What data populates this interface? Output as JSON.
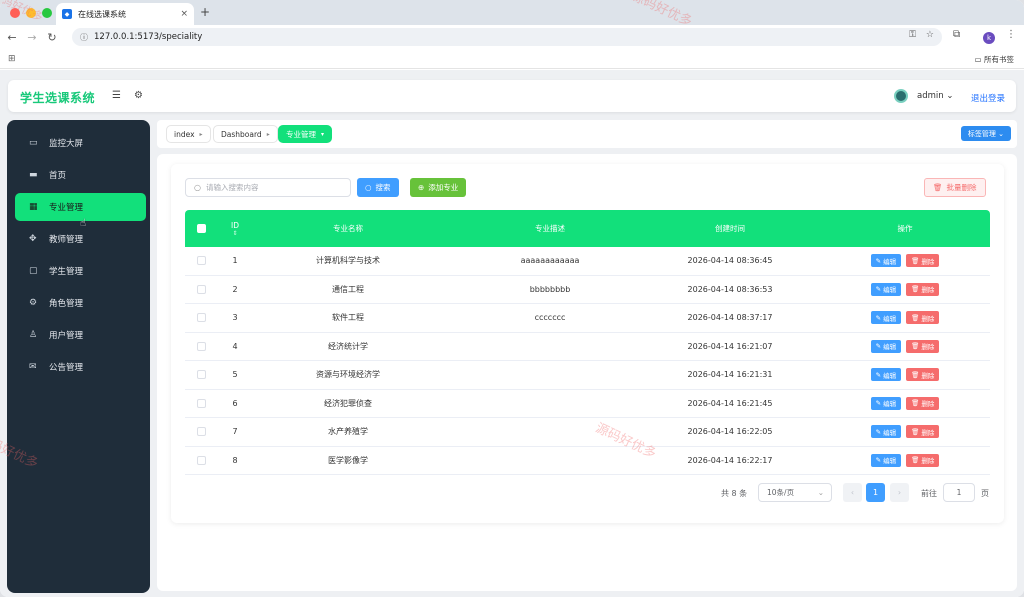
{
  "browser": {
    "tab_title": "在线选课系统",
    "tab_close": "×",
    "new_tab": "+",
    "url": "127.0.0.1:5173/speciality",
    "bookmarks_all": "所有书签",
    "profile_initial": "k"
  },
  "header": {
    "logo": "学生选课系统",
    "username": "admin",
    "logout": "退出登录"
  },
  "sidebar": {
    "items": [
      {
        "label": "监控大屏",
        "icon": "monitor-icon"
      },
      {
        "label": "首页",
        "icon": "desktop-icon"
      },
      {
        "label": "专业管理",
        "icon": "building-icon",
        "active": true
      },
      {
        "label": "教师管理",
        "icon": "move-icon"
      },
      {
        "label": "学生管理",
        "icon": "briefcase-icon"
      },
      {
        "label": "角色管理",
        "icon": "gear-icon"
      },
      {
        "label": "用户管理",
        "icon": "user-icon"
      },
      {
        "label": "公告管理",
        "icon": "mail-icon"
      }
    ]
  },
  "tags": {
    "items": [
      "index",
      "Dashboard",
      "专业管理"
    ],
    "manage": "标签管理"
  },
  "toolbar": {
    "search_placeholder": "请输入搜索内容",
    "search_button": "搜索",
    "add_button": "添加专业",
    "batch_delete": "批量删除"
  },
  "table": {
    "headers": {
      "id": "ID",
      "name": "专业名称",
      "desc": "专业描述",
      "created": "创建时间",
      "actions": "操作"
    },
    "edit_label": "编辑",
    "delete_label": "删除",
    "rows": [
      {
        "id": "1",
        "name": "计算机科学与技术",
        "desc": "aaaaaaaaaaaa",
        "created": "2026-04-14 08:36:45"
      },
      {
        "id": "2",
        "name": "通信工程",
        "desc": "bbbbbbbb",
        "created": "2026-04-14 08:36:53"
      },
      {
        "id": "3",
        "name": "软件工程",
        "desc": "ccccccc",
        "created": "2026-04-14 08:37:17"
      },
      {
        "id": "4",
        "name": "经济统计学",
        "desc": "",
        "created": "2026-04-14 16:21:07"
      },
      {
        "id": "5",
        "name": "资源与环境经济学",
        "desc": "",
        "created": "2026-04-14 16:21:31"
      },
      {
        "id": "6",
        "name": "经济犯罪侦查",
        "desc": "",
        "created": "2026-04-14 16:21:45"
      },
      {
        "id": "7",
        "name": "水产养殖学",
        "desc": "",
        "created": "2026-04-14 16:22:05"
      },
      {
        "id": "8",
        "name": "医学影像学",
        "desc": "",
        "created": "2026-04-14 16:22:17"
      }
    ]
  },
  "pagination": {
    "total": "共 8 条",
    "page_size": "10条/页",
    "current": "1",
    "goto_prefix": "前往",
    "goto_value": "1",
    "goto_suffix": "页"
  },
  "watermark": "源码好优多",
  "colors": {
    "accent": "#12e07b",
    "primary": "#409eff",
    "danger": "#f56c6c",
    "sidebar": "#1f2d3a"
  }
}
